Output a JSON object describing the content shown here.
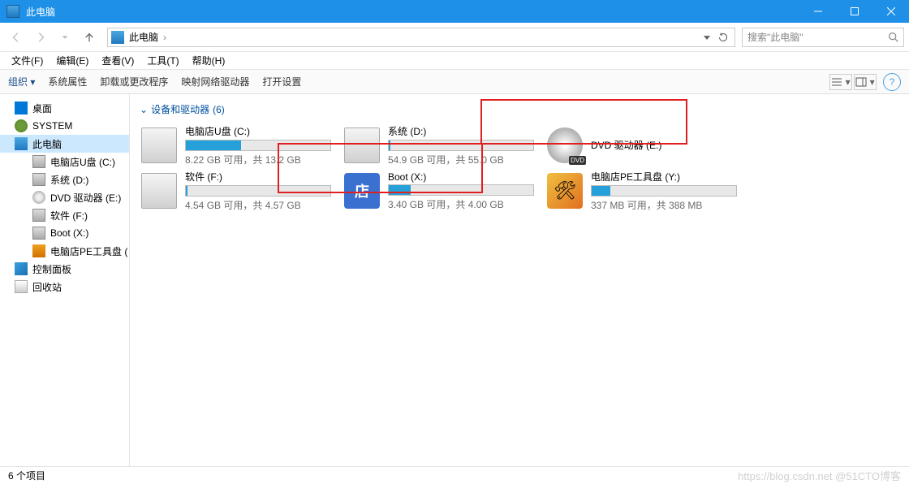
{
  "window": {
    "title": "此电脑"
  },
  "windowControls": {
    "min": "min",
    "max": "max",
    "close": "close"
  },
  "nav": {
    "crumbRoot": "此电脑",
    "crumbSep": "›",
    "searchPlaceholder": "搜索\"此电脑\""
  },
  "menu": [
    {
      "id": "file",
      "label": "文件(F)"
    },
    {
      "id": "edit",
      "label": "编辑(E)"
    },
    {
      "id": "view",
      "label": "查看(V)"
    },
    {
      "id": "tools",
      "label": "工具(T)"
    },
    {
      "id": "help",
      "label": "帮助(H)"
    }
  ],
  "cmd": [
    {
      "id": "org",
      "label": "组织 ▾",
      "accent": true
    },
    {
      "id": "sysprop",
      "label": "系统属性"
    },
    {
      "id": "uninstall",
      "label": "卸载或更改程序"
    },
    {
      "id": "mapnet",
      "label": "映射网络驱动器"
    },
    {
      "id": "settings",
      "label": "打开设置"
    }
  ],
  "tree": [
    {
      "id": "desktop",
      "label": "桌面",
      "depth": 1,
      "icon": "ic-desktop"
    },
    {
      "id": "system-user",
      "label": "SYSTEM",
      "depth": 1,
      "icon": "ic-user"
    },
    {
      "id": "this-pc",
      "label": "此电脑",
      "depth": 1,
      "icon": "ic-pc",
      "selected": true
    },
    {
      "id": "drive-c",
      "label": "电脑店U盘 (C:)",
      "depth": 2,
      "icon": "ic-drive"
    },
    {
      "id": "drive-d",
      "label": "系统 (D:)",
      "depth": 2,
      "icon": "ic-drive"
    },
    {
      "id": "drive-e",
      "label": "DVD 驱动器 (E:)",
      "depth": 2,
      "icon": "ic-dvd"
    },
    {
      "id": "drive-f",
      "label": "软件 (F:)",
      "depth": 2,
      "icon": "ic-drive"
    },
    {
      "id": "drive-x",
      "label": "Boot (X:)",
      "depth": 2,
      "icon": "ic-drive"
    },
    {
      "id": "drive-y",
      "label": "电脑店PE工具盘 (",
      "depth": 2,
      "icon": "ic-pe"
    },
    {
      "id": "ctrl-panel",
      "label": "控制面板",
      "depth": 1,
      "icon": "ic-cp"
    },
    {
      "id": "recycle",
      "label": "回收站",
      "depth": 1,
      "icon": "ic-recycle"
    }
  ],
  "groupHeader": {
    "label": "设备和驱动器",
    "count": "(6)"
  },
  "drives": [
    {
      "id": "c",
      "name": "电脑店U盘 (C:)",
      "sub": "8.22 GB 可用，共 13.2 GB",
      "fill": 38,
      "icon": "disk",
      "hl": false
    },
    {
      "id": "d",
      "name": "系统 (D:)",
      "sub": "54.9 GB 可用，共 55.0 GB",
      "fill": 1,
      "icon": "disk",
      "hl": true
    },
    {
      "id": "e",
      "name": "DVD 驱动器 (E:)",
      "sub": "",
      "fill": null,
      "icon": "dvd",
      "hl": false
    },
    {
      "id": "f",
      "name": "软件 (F:)",
      "sub": "4.54 GB 可用，共 4.57 GB",
      "fill": 1,
      "icon": "disk",
      "hl": true
    },
    {
      "id": "x",
      "name": "Boot (X:)",
      "sub": "3.40 GB 可用，共 4.00 GB",
      "fill": 15,
      "icon": "boot",
      "hl": false
    },
    {
      "id": "y",
      "name": "电脑店PE工具盘 (Y:)",
      "sub": "337 MB 可用，共 388 MB",
      "fill": 13,
      "icon": "pe",
      "hl": false
    }
  ],
  "status": {
    "count": "6 个项目"
  },
  "watermark": "https://blog.csdn.net  @51CTO博客"
}
